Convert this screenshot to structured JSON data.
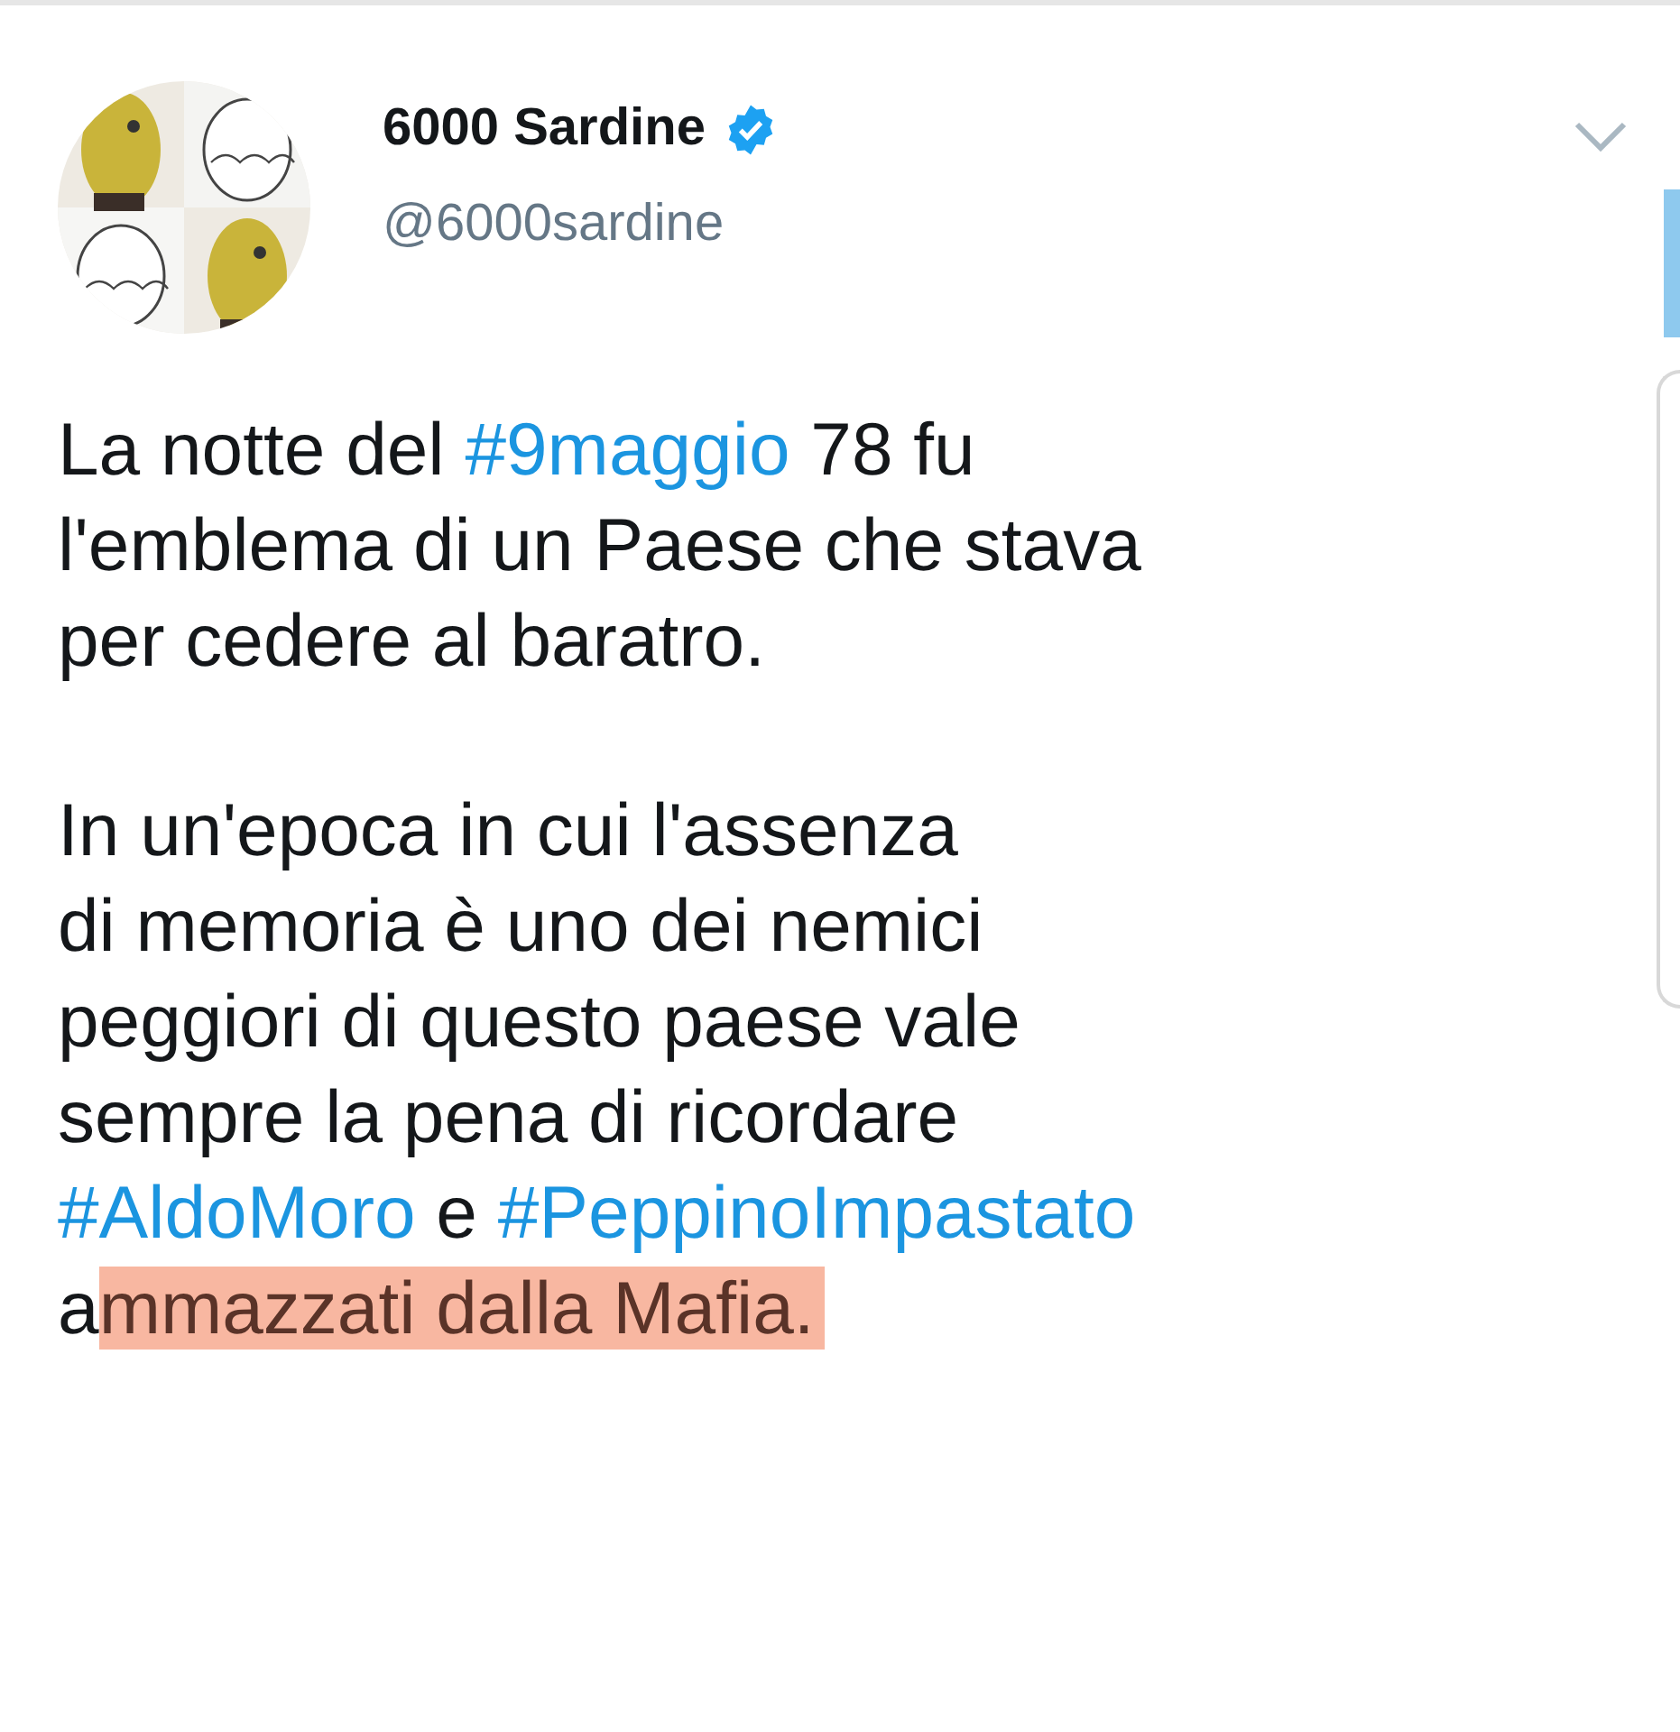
{
  "tweet": {
    "author": {
      "name": "6000 Sardine",
      "verified": true,
      "handle": "@6000sardine"
    },
    "paragraphs": [
      {
        "lines": [
          [
            {
              "kind": "text",
              "text": "La notte del "
            },
            {
              "kind": "hashtag",
              "text": "#9maggio"
            },
            {
              "kind": "text",
              "text": " 78 fu"
            }
          ],
          [
            {
              "kind": "text",
              "text": "l'emblema di un Paese che stava"
            }
          ],
          [
            {
              "kind": "text",
              "text": "per cedere al baratro."
            }
          ]
        ]
      },
      {
        "lines": [
          [
            {
              "kind": "text",
              "text": "In un'epoca in cui l'assenza"
            }
          ],
          [
            {
              "kind": "text",
              "text": "di memoria è uno dei nemici"
            }
          ],
          [
            {
              "kind": "text",
              "text": "peggiori di questo paese vale"
            }
          ],
          [
            {
              "kind": "text",
              "text": "sempre la pena di ricordare"
            }
          ],
          [
            {
              "kind": "hashtag",
              "text": "#AldoMoro"
            },
            {
              "kind": "text",
              "text": " e "
            },
            {
              "kind": "hashtag",
              "text": "#PeppinoImpastato"
            }
          ],
          [
            {
              "kind": "text",
              "text": "a"
            },
            {
              "kind": "highlight",
              "text": "mmazzati dalla Mafia."
            }
          ]
        ]
      }
    ]
  }
}
